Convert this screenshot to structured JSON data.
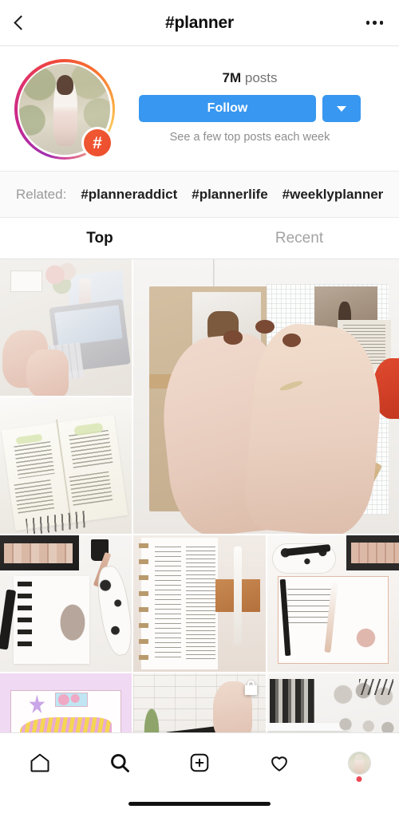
{
  "header": {
    "title": "#planner",
    "back_icon": "chevron-left-icon",
    "more_icon": "ellipsis-icon"
  },
  "profile": {
    "avatar_icon": "hashtag-avatar",
    "badge_glyph": "#",
    "posts_count": "7M",
    "posts_label": "posts",
    "follow_label": "Follow",
    "follow_more_icon": "chevron-down-icon",
    "note": "See a few top posts each week",
    "accent_color": "#3897f0"
  },
  "related": {
    "label": "Related:",
    "tags": [
      "#planneraddict",
      "#plannerlife",
      "#weeklyplanner"
    ]
  },
  "tabs": [
    {
      "label": "Top",
      "active": true
    },
    {
      "label": "Recent",
      "active": false
    }
  ],
  "grid": {
    "items": [
      {
        "name": "post-desk-laptop",
        "art": "c1",
        "feature": false,
        "shoppable": false
      },
      {
        "name": "post-hands-journal",
        "art": "cf",
        "feature": true,
        "shoppable": false
      },
      {
        "name": "post-bullet-journal-bed",
        "art": "c2",
        "feature": false,
        "shoppable": false
      },
      {
        "name": "post-flatlay-palette",
        "art": "c3a",
        "feature": false,
        "shoppable": false
      },
      {
        "name": "post-ring-binder",
        "art": "c3b",
        "feature": false,
        "shoppable": false
      },
      {
        "name": "post-open-journal",
        "art": "c3c",
        "feature": false,
        "shoppable": false
      },
      {
        "name": "post-pastel-lettering",
        "art": "c4a",
        "feature": false,
        "shoppable": false
      },
      {
        "name": "post-hand-holding-planner",
        "art": "c4b",
        "feature": false,
        "shoppable": true
      },
      {
        "name": "post-office-shelf",
        "art": "c4c",
        "feature": false,
        "shoppable": false
      }
    ],
    "shop_icon": "shopping-bag-icon"
  },
  "bottom_nav": {
    "items": [
      {
        "name": "nav-home",
        "icon": "home-icon",
        "active": false
      },
      {
        "name": "nav-search",
        "icon": "search-icon",
        "active": true
      },
      {
        "name": "nav-create",
        "icon": "plus-square-icon",
        "active": false
      },
      {
        "name": "nav-activity",
        "icon": "heart-icon",
        "active": false
      },
      {
        "name": "nav-profile",
        "icon": "profile-avatar-icon",
        "active": false,
        "badge": true
      }
    ]
  }
}
